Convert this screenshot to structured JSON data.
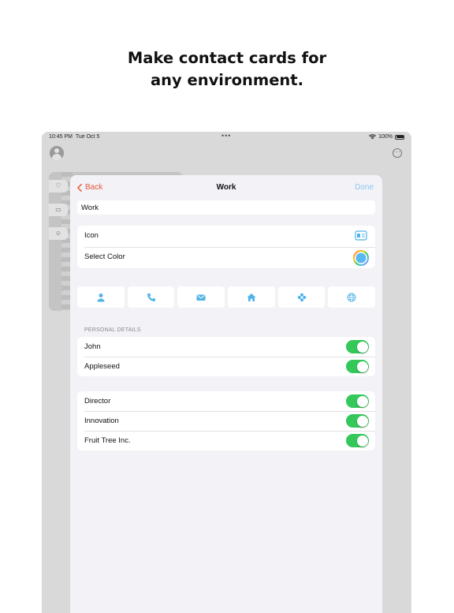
{
  "headline": {
    "line1": "Make contact cards for",
    "line2": "any environment."
  },
  "status_bar": {
    "time": "10:45 PM",
    "date": "Tue Oct 5",
    "dots": "•••",
    "battery": "100%"
  },
  "nav": {
    "back_label": "Back",
    "title": "Work",
    "done_label": "Done"
  },
  "name_field": {
    "value": "Work"
  },
  "appearance": {
    "icon_label": "Icon",
    "color_label": "Select Color"
  },
  "field_types": [
    {
      "icon": "person-icon"
    },
    {
      "icon": "phone-icon"
    },
    {
      "icon": "envelope-icon"
    },
    {
      "icon": "house-icon"
    },
    {
      "icon": "flower-icon"
    },
    {
      "icon": "globe-icon"
    }
  ],
  "personal_details": {
    "header": "PERSONAL DETAILS",
    "rows": [
      {
        "label": "John",
        "enabled": true
      },
      {
        "label": "Appleseed",
        "enabled": true
      }
    ]
  },
  "work_details": {
    "rows": [
      {
        "label": "Director",
        "enabled": true
      },
      {
        "label": "Innovation",
        "enabled": true
      },
      {
        "label": "Fruit Tree Inc.",
        "enabled": true
      }
    ]
  },
  "colors": {
    "accent_back": "#e8583a",
    "accent_done": "#8fc8ef",
    "icon_blue": "#4fb3e8",
    "toggle_on": "#34c759",
    "selected_color": "#5ab8f0"
  }
}
